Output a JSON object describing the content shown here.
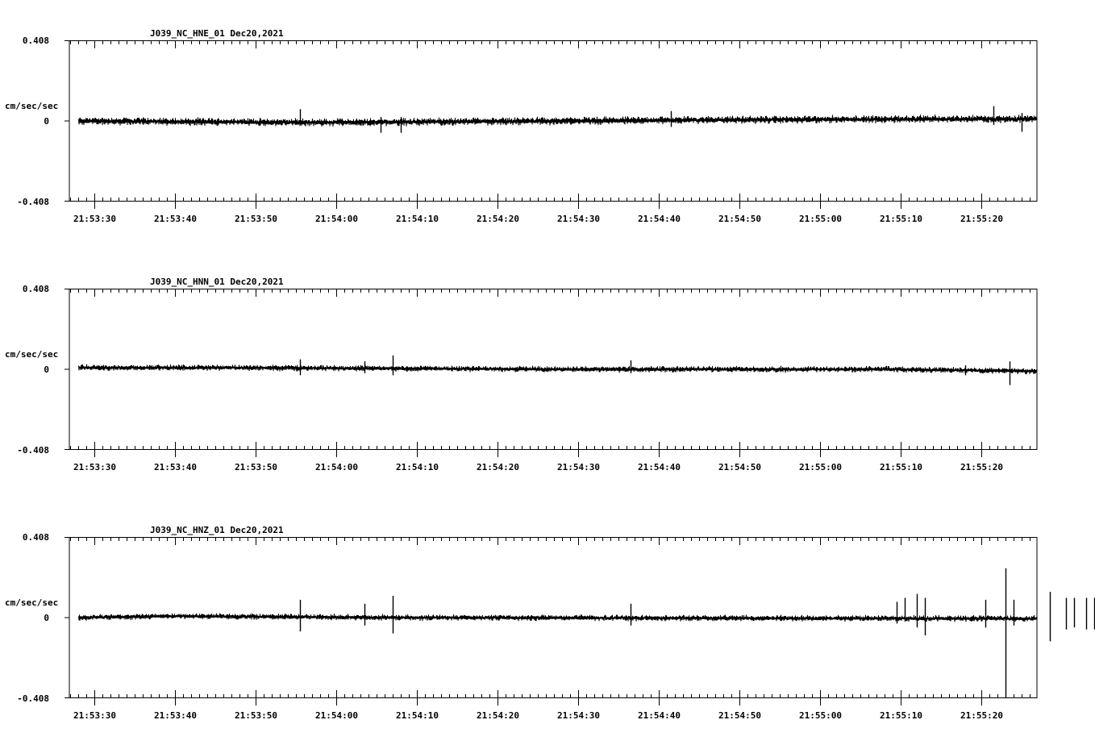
{
  "chart_data": [
    {
      "type": "line",
      "title": "J039_NC_HNE_01   Dec20,2021",
      "ylabel": "cm/sec/sec",
      "ylim": [
        -0.408,
        0.408
      ],
      "y_tick_labels": [
        "0.408",
        "0",
        "-0.408"
      ],
      "x_tick_labels": [
        "21:53:30",
        "21:53:40",
        "21:53:50",
        "21:54:00",
        "21:54:10",
        "21:54:20",
        "21:54:30",
        "21:54:40",
        "21:54:50",
        "21:55:00",
        "21:55:10",
        "21:55:20"
      ],
      "xlim": [
        "21:53:27",
        "21:55:27"
      ],
      "series": [
        {
          "trend": [
            [
              0,
              0.0
            ],
            [
              30,
              -0.008
            ],
            [
              60,
              0.0
            ],
            [
              90,
              0.008
            ],
            [
              120,
              0.01
            ]
          ],
          "noise": 0.013,
          "spikes": [
            [
              27.5,
              0.06,
              -0.02
            ],
            [
              37.5,
              0.02,
              -0.06
            ],
            [
              40,
              0.02,
              -0.06
            ],
            [
              73.5,
              0.05,
              -0.03
            ],
            [
              113.5,
              0.075,
              -0.02
            ],
            [
              117,
              0.04,
              -0.055
            ]
          ]
        }
      ]
    },
    {
      "type": "line",
      "title": "J039_NC_HNN_01   Dec20,2021",
      "ylabel": "cm/sec/sec",
      "ylim": [
        -0.408,
        0.408
      ],
      "y_tick_labels": [
        "0.408",
        "0",
        "-0.408"
      ],
      "x_tick_labels": [
        "21:53:30",
        "21:53:40",
        "21:53:50",
        "21:54:00",
        "21:54:10",
        "21:54:20",
        "21:54:30",
        "21:54:40",
        "21:54:50",
        "21:55:00",
        "21:55:10",
        "21:55:20"
      ],
      "xlim": [
        "21:53:27",
        "21:55:27"
      ],
      "series": [
        {
          "trend": [
            [
              0,
              0.008
            ],
            [
              20,
              0.008
            ],
            [
              60,
              0.0
            ],
            [
              100,
              0.0
            ],
            [
              120,
              -0.01
            ]
          ],
          "noise": 0.01,
          "spikes": [
            [
              27.5,
              0.05,
              -0.03
            ],
            [
              35.5,
              0.04,
              -0.02
            ],
            [
              39,
              0.07,
              -0.03
            ],
            [
              68.5,
              0.045,
              -0.02
            ],
            [
              115.5,
              0.04,
              -0.08
            ],
            [
              110,
              0.02,
              -0.03
            ]
          ]
        }
      ]
    },
    {
      "type": "line",
      "title": "J039_NC_HNZ_01   Dec20,2021",
      "ylabel": "cm/sec/sec",
      "ylim": [
        -0.408,
        0.408
      ],
      "y_tick_labels": [
        "0.408",
        "0",
        "-0.408"
      ],
      "x_tick_labels": [
        "21:53:30",
        "21:53:40",
        "21:53:50",
        "21:54:00",
        "21:54:10",
        "21:54:20",
        "21:54:30",
        "21:54:40",
        "21:54:50",
        "21:55:00",
        "21:55:10",
        "21:55:20"
      ],
      "xlim": [
        "21:53:27",
        "21:55:27"
      ],
      "series": [
        {
          "trend": [
            [
              0,
              0.0
            ],
            [
              12,
              0.008
            ],
            [
              40,
              0.0
            ],
            [
              120,
              -0.005
            ]
          ],
          "noise": 0.01,
          "spikes": [
            [
              27.5,
              0.09,
              -0.07
            ],
            [
              35.5,
              0.07,
              -0.04
            ],
            [
              39,
              0.11,
              -0.08
            ],
            [
              68.5,
              0.07,
              -0.04
            ],
            [
              101.5,
              0.08,
              -0.03
            ],
            [
              102.5,
              0.1,
              -0.02
            ],
            [
              104,
              0.12,
              -0.05
            ],
            [
              105,
              0.1,
              -0.09
            ],
            [
              112.5,
              0.09,
              -0.05
            ],
            [
              115,
              0.25,
              -0.408
            ],
            [
              116,
              0.09,
              -0.04
            ],
            [
              120.5,
              0.13,
              -0.12
            ],
            [
              122.5,
              0.1,
              -0.06
            ],
            [
              123.5,
              0.1,
              -0.05
            ],
            [
              125,
              0.1,
              -0.06
            ],
            [
              126,
              0.1,
              -0.06
            ],
            [
              127,
              0.1,
              -0.06
            ]
          ]
        }
      ]
    }
  ]
}
